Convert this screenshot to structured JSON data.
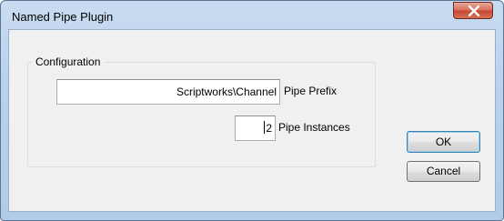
{
  "window": {
    "title": "Named Pipe Plugin"
  },
  "titlebar": {
    "close_icon": "close-icon"
  },
  "configuration": {
    "group_label": "Configuration",
    "pipe_prefix": {
      "value": "Scriptworks\\Channel",
      "label": "Pipe Prefix"
    },
    "pipe_instances": {
      "value": "2",
      "label": "Pipe Instances"
    }
  },
  "buttons": {
    "ok_label": "OK",
    "cancel_label": "Cancel"
  },
  "colors": {
    "frame": "#b9d1ec",
    "client": "#f0f0f0",
    "close_button": "#c44a32",
    "default_button_border": "#3c7fb1"
  }
}
